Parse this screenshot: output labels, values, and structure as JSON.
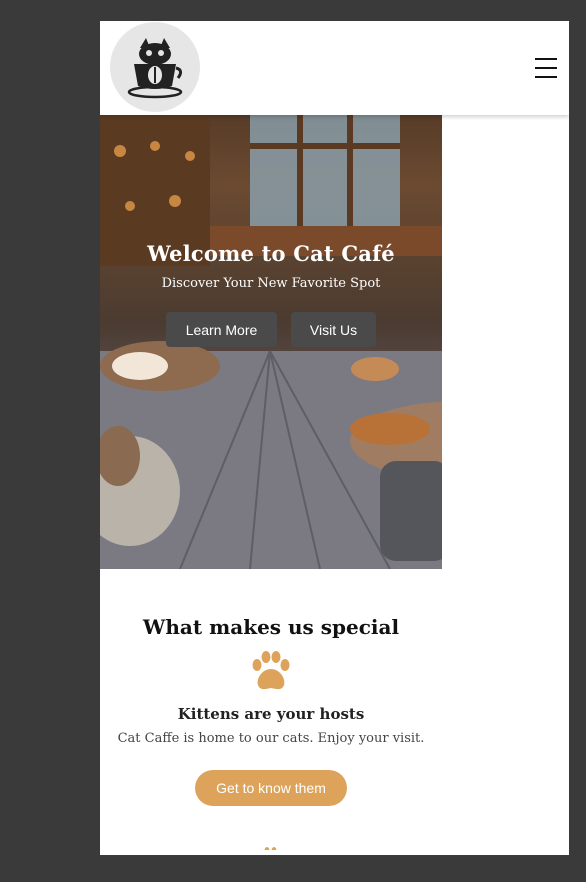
{
  "hero": {
    "title": "Welcome to Cat Café",
    "subtitle": "Discover Your New Favorite Spot",
    "learn_more_label": "Learn More",
    "visit_us_label": "Visit Us"
  },
  "features": {
    "heading": "What makes us special",
    "items": [
      {
        "icon": "paw-icon",
        "title": "Kittens are your hosts",
        "text": "Cat Caffe is home to our cats. Enjoy your visit.",
        "button_label": "Get to know them"
      }
    ]
  },
  "colors": {
    "accent": "#dda35a",
    "button_dark": "#4a4a4a",
    "page_background": "#3a3a3a"
  }
}
